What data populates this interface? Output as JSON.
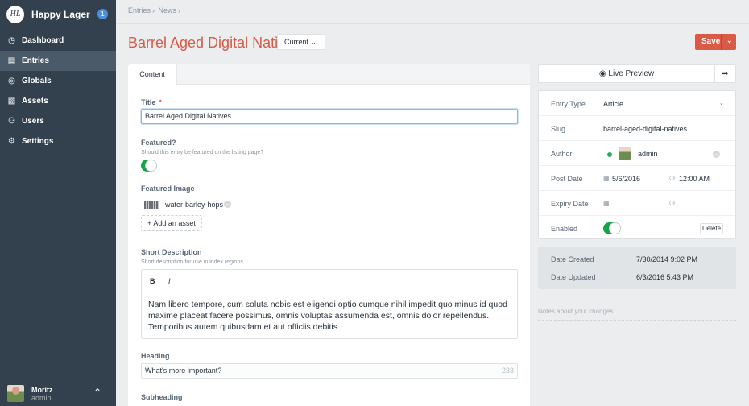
{
  "site": {
    "logo_text": "HL",
    "name": "Happy Lager",
    "badge": "1"
  },
  "nav": [
    {
      "label": "Dashboard",
      "icon": "dashboard-icon",
      "glyph": "◷"
    },
    {
      "label": "Entries",
      "icon": "entries-icon",
      "glyph": "▤"
    },
    {
      "label": "Globals",
      "icon": "globe-icon",
      "glyph": "◎"
    },
    {
      "label": "Assets",
      "icon": "assets-icon",
      "glyph": "▧"
    },
    {
      "label": "Users",
      "icon": "users-icon",
      "glyph": "⚇"
    },
    {
      "label": "Settings",
      "icon": "gear-icon",
      "glyph": "⚙"
    }
  ],
  "active_nav": "Entries",
  "user": {
    "name": "Moritz",
    "role": "admin"
  },
  "breadcrumb": [
    "Entries",
    "News"
  ],
  "page": {
    "title": "Barrel Aged Digital Natives",
    "revision": "Current",
    "save_label": "Save"
  },
  "tabs": [
    "Content"
  ],
  "fields": {
    "title": {
      "label": "Title",
      "required": "*",
      "value": "Barrel Aged Digital Natives"
    },
    "featured": {
      "label": "Featured?",
      "help": "Should this entry be featured on the listing page?",
      "on": true
    },
    "featured_image": {
      "label": "Featured Image",
      "asset": "water-barley-hops",
      "add_label": "Add an asset"
    },
    "short_description": {
      "label": "Short Description",
      "help": "Short description for use in index regions.",
      "bold": "B",
      "italic": "I",
      "body": "Nam libero tempore, cum soluta nobis est eligendi optio cumque nihil impedit quo minus id quod maxime placeat facere possimus, omnis voluptas assumenda est, omnis dolor repellendus. Temporibus autem quibusdam et aut officiis debitis."
    },
    "heading": {
      "label": "Heading",
      "value": "What's more important?",
      "count": "233"
    },
    "subheading": {
      "label": "Subheading"
    }
  },
  "sidebar": {
    "live_preview": "Live Preview",
    "entry_type": {
      "label": "Entry Type",
      "value": "Article"
    },
    "slug": {
      "label": "Slug",
      "value": "barrel-aged-digital-natives"
    },
    "author": {
      "label": "Author",
      "value": "admin"
    },
    "post_date": {
      "label": "Post Date",
      "date": "5/6/2016",
      "time": "12:00 AM"
    },
    "expiry_date": {
      "label": "Expiry Date"
    },
    "enabled": {
      "label": "Enabled",
      "on": true,
      "delete_label": "Delete"
    },
    "date_created": {
      "label": "Date Created",
      "value": "7/30/2014 9:02 PM"
    },
    "date_updated": {
      "label": "Date Updated",
      "value": "6/3/2016 5:43 PM"
    },
    "notes_placeholder": "Notes about your changes"
  },
  "colors": {
    "accent": "#da5a47",
    "sidebar": "#33404d",
    "toggle_on": "#17a34a"
  }
}
